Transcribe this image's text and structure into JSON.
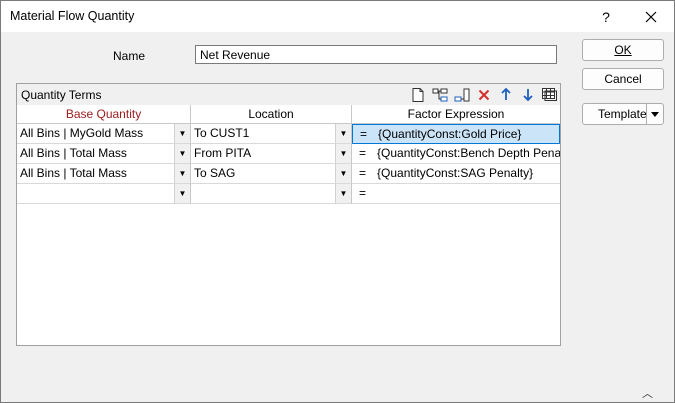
{
  "window": {
    "title": "Material Flow Quantity"
  },
  "titlebar": {
    "help_label": "?"
  },
  "name_field": {
    "label": "Name",
    "value": "Net Revenue"
  },
  "buttons": {
    "ok": "OK",
    "cancel": "Cancel",
    "template": "Template"
  },
  "quantity_terms": {
    "title": "Quantity Terms",
    "toolbar": [
      "new-icon",
      "insert-row-icon",
      "append-row-icon",
      "delete-icon",
      "move-up-icon",
      "move-down-icon",
      "grid-options-icon"
    ],
    "columns": {
      "base_quantity": "Base Quantity",
      "location": "Location",
      "factor_expression": "Factor Expression"
    },
    "rows": [
      {
        "base_quantity": "All Bins | MyGold Mass",
        "location": "To CUST1",
        "operator": "=",
        "factor_expression": "{QuantityConst:Gold Price}"
      },
      {
        "base_quantity": "All Bins | Total Mass",
        "location": "From PITA",
        "operator": "=",
        "factor_expression": "{QuantityConst:Bench Depth Penalty}"
      },
      {
        "base_quantity": "All Bins | Total Mass",
        "location": "To SAG",
        "operator": "=",
        "factor_expression": "{QuantityConst:SAG Penalty}"
      },
      {
        "base_quantity": "",
        "location": "",
        "operator": "=",
        "factor_expression": ""
      }
    ]
  },
  "colors": {
    "base_quantity_header": "#9b1b1b",
    "selection": "#cce4f7",
    "delete_icon": "#d32f2f",
    "arrow_icon": "#1f5fbf"
  }
}
